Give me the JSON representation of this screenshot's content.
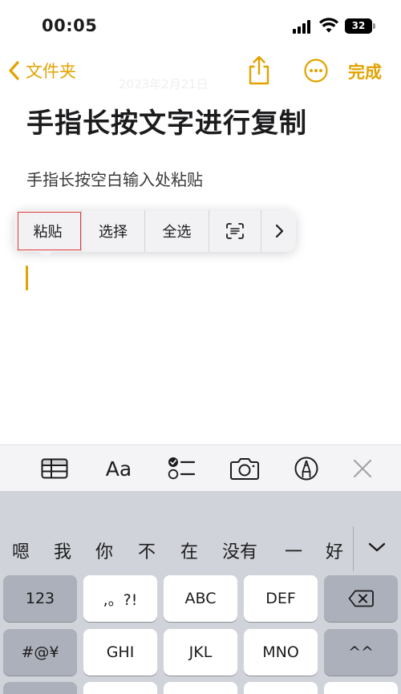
{
  "status_bar": {
    "time": "00:05",
    "battery_level": "32"
  },
  "nav": {
    "back_label": "文件夹",
    "done_label": "完成",
    "accent_color": "#e2a300"
  },
  "note": {
    "faded_date": "2023年2月21日",
    "title": "手指长按文字进行复制",
    "body": "手指长按空白输入处粘贴"
  },
  "edit_menu": {
    "paste": "粘贴",
    "select": "选择",
    "select_all": "全选",
    "scan_icon": "scan-text-icon",
    "more_icon": "chevron-right-icon",
    "highlight_color": "#e03a3a"
  },
  "toolbar": {
    "icons": [
      "table-icon",
      "text-format-icon",
      "checklist-icon",
      "camera-icon",
      "markup-pen-icon",
      "close-icon"
    ],
    "format_label": "Aa"
  },
  "keyboard": {
    "candidates": [
      "嗯",
      "我",
      "你",
      "不",
      "在",
      "没有",
      "一",
      "好"
    ],
    "row1": [
      "123",
      ",。?!",
      "ABC",
      "DEF"
    ],
    "row2": [
      "#@¥",
      "GHI",
      "JKL",
      "MNO",
      "^^"
    ],
    "delete_icon": "backspace-icon",
    "expand_icon": "chevron-down-icon"
  }
}
